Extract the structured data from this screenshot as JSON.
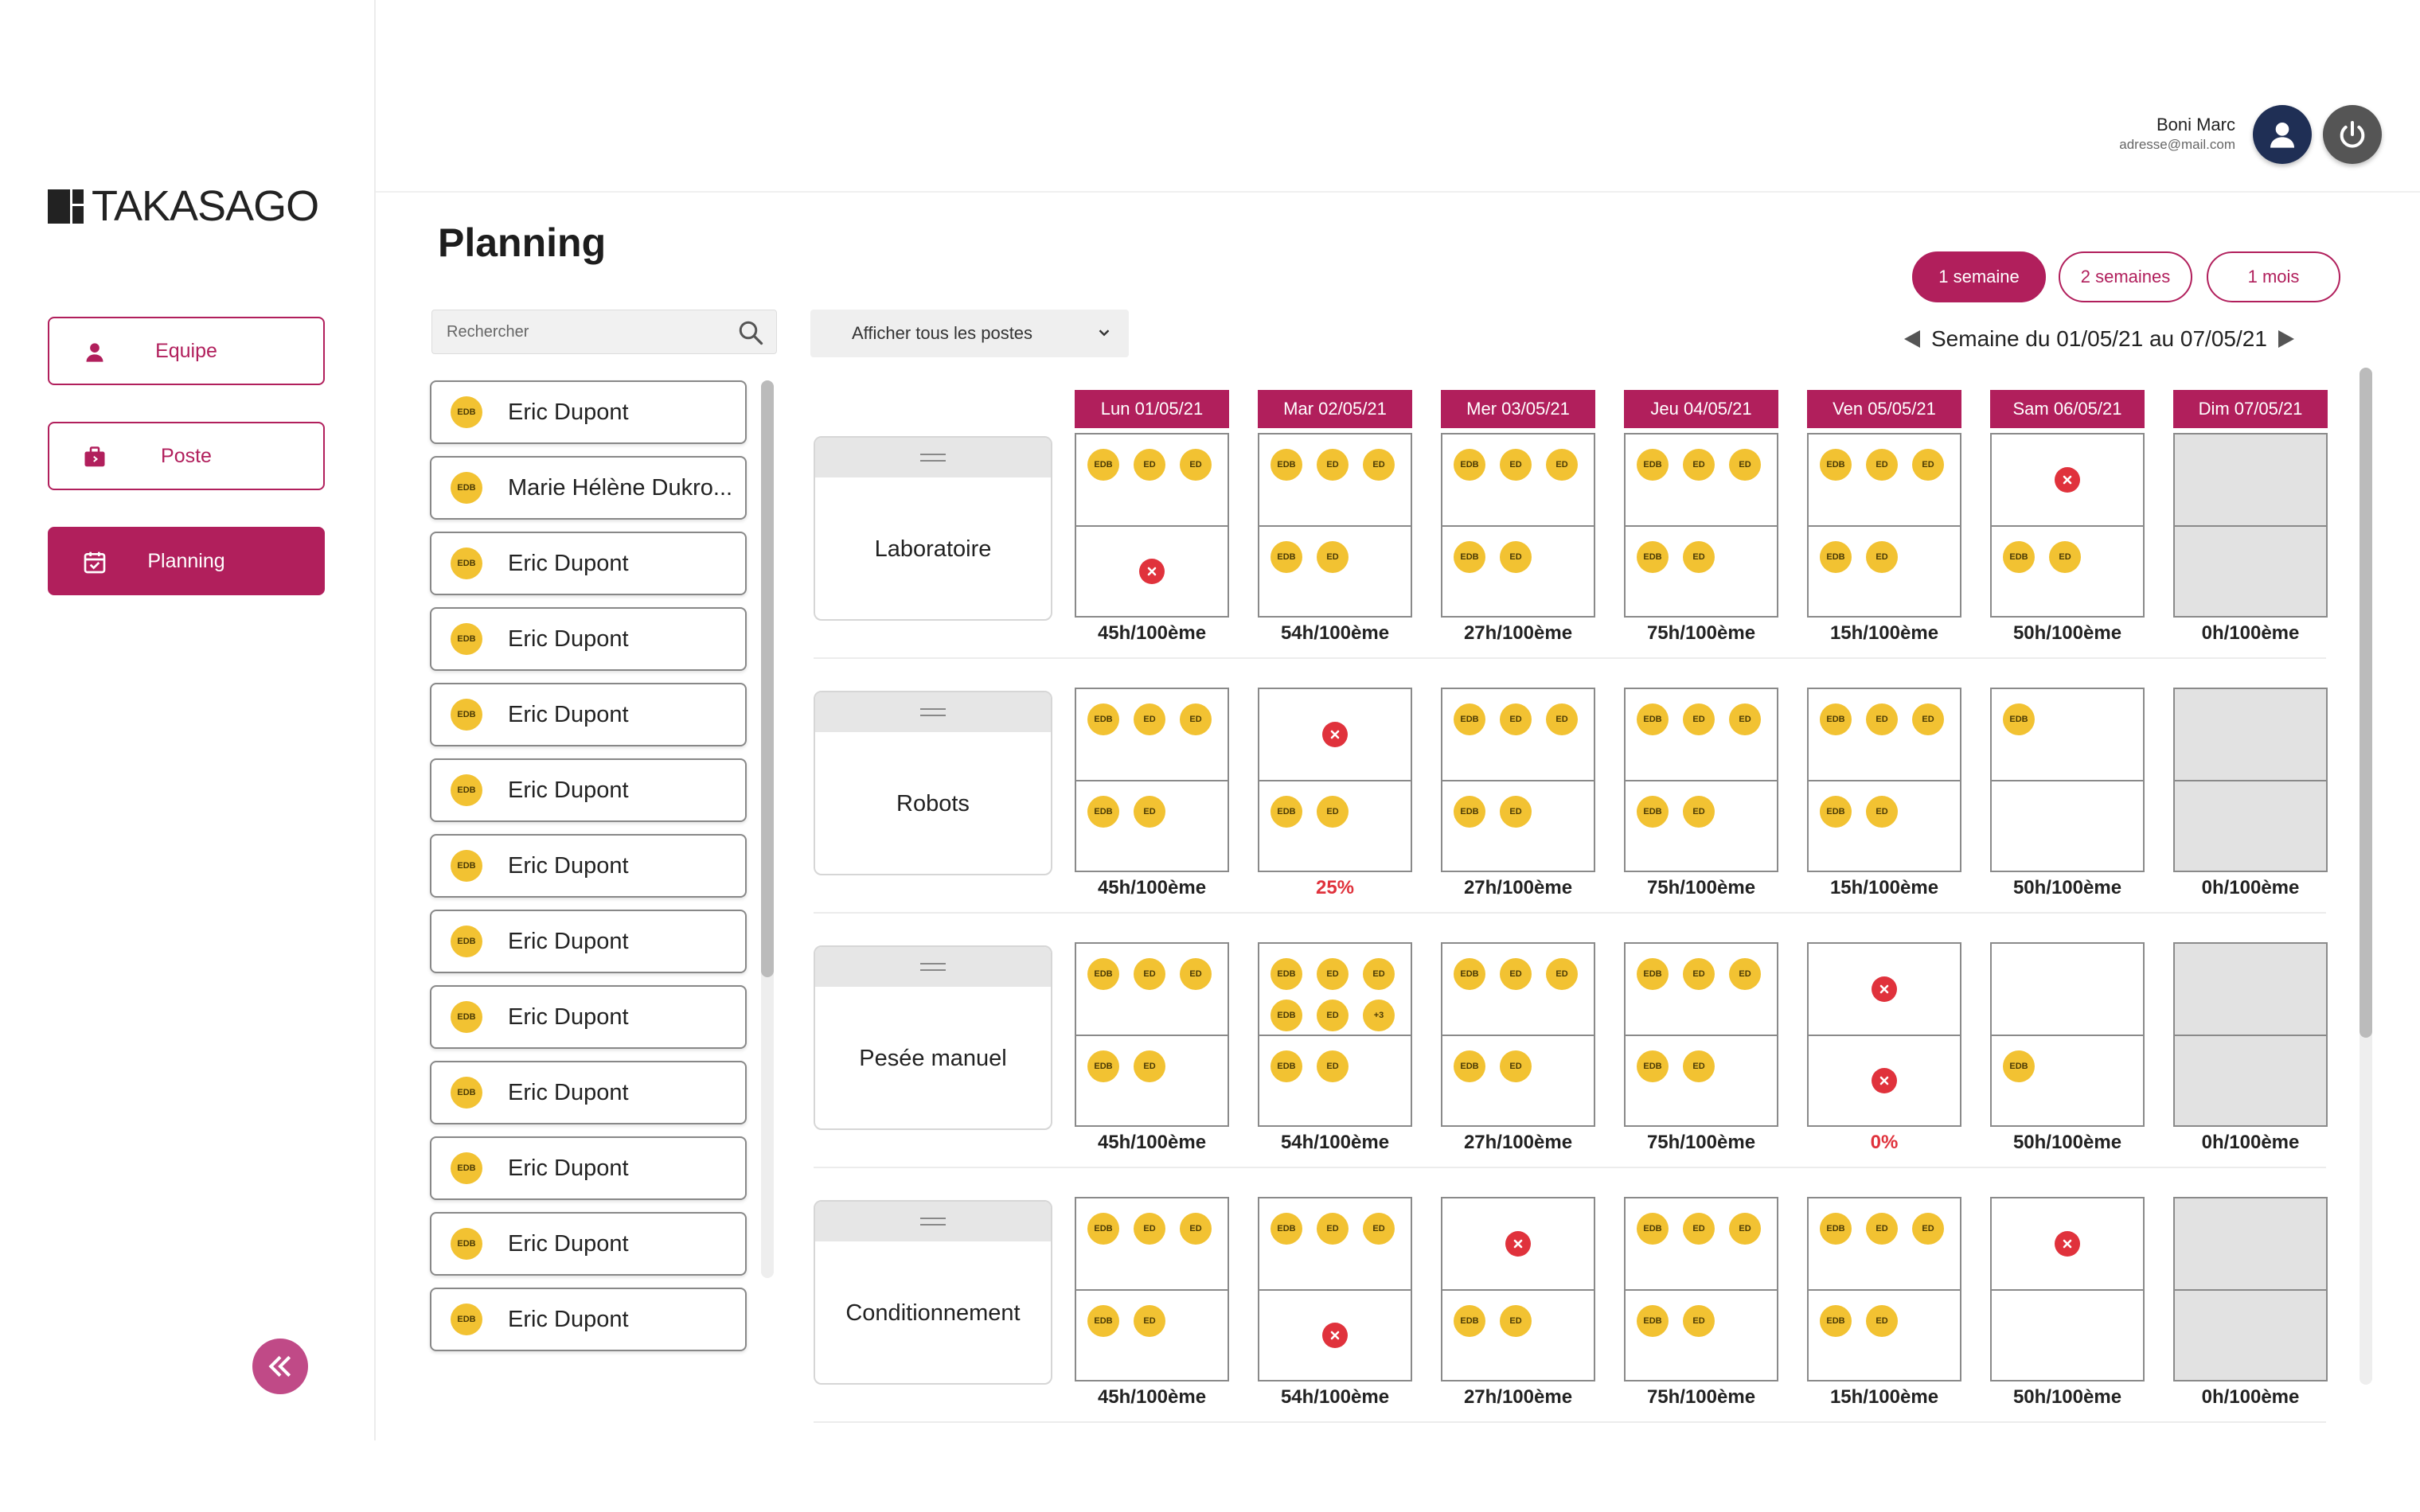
{
  "brand": {
    "name": "TAKASAGO",
    "accent": "#b11f5c"
  },
  "sidebar": {
    "items": [
      {
        "label": "Equipe",
        "icon": "person-icon"
      },
      {
        "label": "Poste",
        "icon": "briefcase-icon"
      },
      {
        "label": "Planning",
        "icon": "calendar-check-icon"
      }
    ],
    "collapse_icon": "double-chevron-left-icon"
  },
  "user": {
    "name": "Boni Marc",
    "email": "adresse@mail.com"
  },
  "page": {
    "title": "Planning"
  },
  "ranges": [
    "1 semaine",
    "2 semaines",
    "1 mois"
  ],
  "week_label": "Semaine du 01/05/21 au 07/05/21",
  "search": {
    "placeholder": "Rechercher"
  },
  "poste_filter": {
    "label": "Afficher tous les postes"
  },
  "employees": [
    {
      "initials": "EDB",
      "name": "Eric Dupont"
    },
    {
      "initials": "EDB",
      "name": "Marie Hélène Dukro..."
    },
    {
      "initials": "EDB",
      "name": "Eric Dupont"
    },
    {
      "initials": "EDB",
      "name": "Eric Dupont"
    },
    {
      "initials": "EDB",
      "name": "Eric Dupont"
    },
    {
      "initials": "EDB",
      "name": "Eric Dupont"
    },
    {
      "initials": "EDB",
      "name": "Eric Dupont"
    },
    {
      "initials": "EDB",
      "name": "Eric Dupont"
    },
    {
      "initials": "EDB",
      "name": "Eric Dupont"
    },
    {
      "initials": "EDB",
      "name": "Eric Dupont"
    },
    {
      "initials": "EDB",
      "name": "Eric Dupont"
    },
    {
      "initials": "EDB",
      "name": "Eric Dupont"
    },
    {
      "initials": "EDB",
      "name": "Eric Dupont"
    }
  ],
  "days": [
    "Lun 01/05/21",
    "Mar 02/05/21",
    "Mer 03/05/21",
    "Jeu 04/05/21",
    "Ven 05/05/21",
    "Sam 06/05/21",
    "Dim 07/05/21"
  ],
  "postes": [
    {
      "name": "Laboratoire",
      "cells": [
        {
          "top": [
            "EDB",
            "ED",
            "ED"
          ],
          "bottom": "X",
          "total": "45h/100ème"
        },
        {
          "top": [
            "EDB",
            "ED",
            "ED"
          ],
          "bottom": [
            "EDB",
            "ED"
          ],
          "total": "54h/100ème"
        },
        {
          "top": [
            "EDB",
            "ED",
            "ED"
          ],
          "bottom": [
            "EDB",
            "ED"
          ],
          "total": "27h/100ème"
        },
        {
          "top": [
            "EDB",
            "ED",
            "ED"
          ],
          "bottom": [
            "EDB",
            "ED"
          ],
          "total": "75h/100ème"
        },
        {
          "top": [
            "EDB",
            "ED",
            "ED"
          ],
          "bottom": [
            "EDB",
            "ED"
          ],
          "total": "15h/100ème"
        },
        {
          "top": "X",
          "bottom": [
            "EDB",
            "ED"
          ],
          "total": "50h/100ème"
        },
        {
          "disabled": true,
          "total": "0h/100ème"
        }
      ]
    },
    {
      "name": "Robots",
      "cells": [
        {
          "top": [
            "EDB",
            "ED",
            "ED"
          ],
          "bottom": [
            "EDB",
            "ED"
          ],
          "total": "45h/100ème"
        },
        {
          "top": "X",
          "bottom": [
            "EDB",
            "ED"
          ],
          "total": "25%",
          "alert": true
        },
        {
          "top": [
            "EDB",
            "ED",
            "ED"
          ],
          "bottom": [
            "EDB",
            "ED"
          ],
          "total": "27h/100ème"
        },
        {
          "top": [
            "EDB",
            "ED",
            "ED"
          ],
          "bottom": [
            "EDB",
            "ED"
          ],
          "total": "75h/100ème"
        },
        {
          "top": [
            "EDB",
            "ED",
            "ED"
          ],
          "bottom": [
            "EDB",
            "ED"
          ],
          "total": "15h/100ème"
        },
        {
          "top": [
            "EDB"
          ],
          "bottom": [],
          "total": "50h/100ème"
        },
        {
          "disabled": true,
          "total": "0h/100ème"
        }
      ]
    },
    {
      "name": "Pesée manuel",
      "cells": [
        {
          "top": [
            "EDB",
            "ED",
            "ED"
          ],
          "bottom": [
            "EDB",
            "ED"
          ],
          "total": "45h/100ème"
        },
        {
          "top": [
            "EDB",
            "ED",
            "ED",
            "EDB",
            "ED",
            "+3"
          ],
          "bottom": [
            "EDB",
            "ED"
          ],
          "total": "54h/100ème"
        },
        {
          "top": [
            "EDB",
            "ED",
            "ED"
          ],
          "bottom": [
            "EDB",
            "ED"
          ],
          "total": "27h/100ème"
        },
        {
          "top": [
            "EDB",
            "ED",
            "ED"
          ],
          "bottom": [
            "EDB",
            "ED"
          ],
          "total": "75h/100ème"
        },
        {
          "top": "X",
          "bottom": "X",
          "total": "0%",
          "alert": true
        },
        {
          "top": [],
          "bottom": [
            "EDB"
          ],
          "total": "50h/100ème"
        },
        {
          "disabled": true,
          "total": "0h/100ème"
        }
      ]
    },
    {
      "name": "Conditionnement",
      "cells": [
        {
          "top": [
            "EDB",
            "ED",
            "ED"
          ],
          "bottom": [
            "EDB",
            "ED"
          ],
          "total": "45h/100ème"
        },
        {
          "top": [
            "EDB",
            "ED",
            "ED"
          ],
          "bottom": "X",
          "total": "54h/100ème"
        },
        {
          "top": "X",
          "bottom": [
            "EDB",
            "ED"
          ],
          "total": "27h/100ème"
        },
        {
          "top": [
            "EDB",
            "ED",
            "ED"
          ],
          "bottom": [
            "EDB",
            "ED"
          ],
          "total": "75h/100ème"
        },
        {
          "top": [
            "EDB",
            "ED",
            "ED"
          ],
          "bottom": [
            "EDB",
            "ED"
          ],
          "total": "15h/100ème"
        },
        {
          "top": "X",
          "bottom": [],
          "total": "50h/100ème"
        },
        {
          "disabled": true,
          "total": "0h/100ème"
        }
      ]
    }
  ]
}
